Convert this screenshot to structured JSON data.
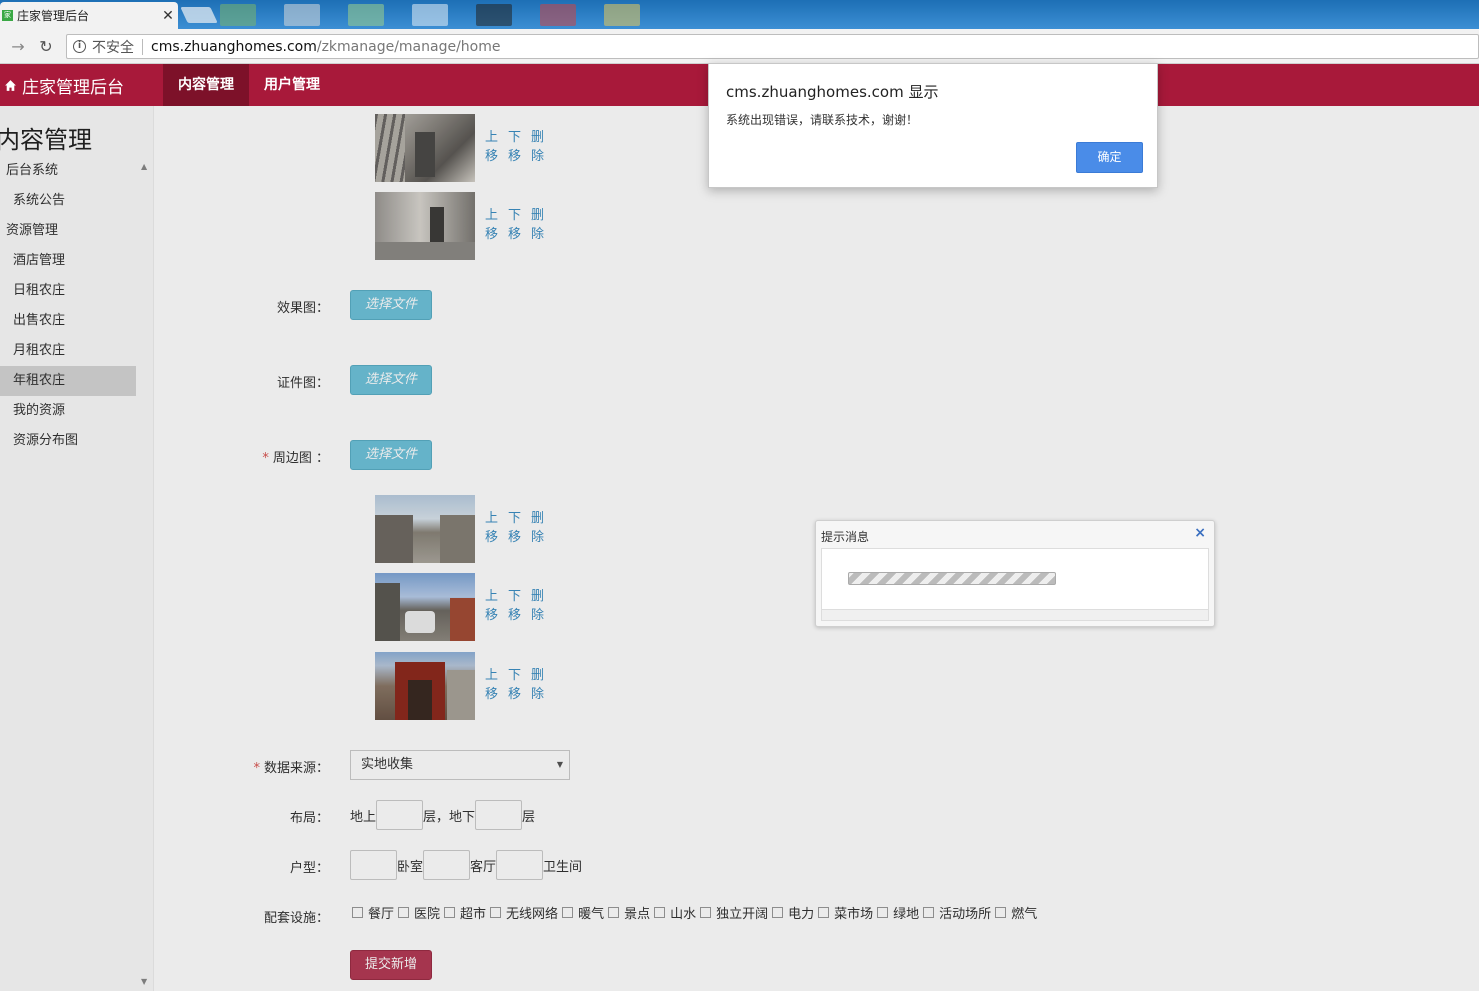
{
  "browser": {
    "tab_title": "庄家管理后台",
    "tab_favicon": "家",
    "insecure_label": "不安全",
    "url_host": "cms.zhuanghomes.com",
    "url_path": "/zkmanage/manage/home"
  },
  "header": {
    "brand": "庄家管理后台",
    "nav": [
      "内容管理",
      "用户管理"
    ]
  },
  "sidebar": {
    "title": "内容管理",
    "items": [
      {
        "label": "后台系统",
        "type": "group"
      },
      {
        "label": "系统公告",
        "type": "sub"
      },
      {
        "label": "资源管理",
        "type": "group"
      },
      {
        "label": "酒店管理",
        "type": "sub"
      },
      {
        "label": "日租农庄",
        "type": "sub"
      },
      {
        "label": "出售农庄",
        "type": "sub"
      },
      {
        "label": "月租农庄",
        "type": "sub"
      },
      {
        "label": "年租农庄",
        "type": "sub",
        "selected": true
      },
      {
        "label": "我的资源",
        "type": "sub"
      },
      {
        "label": "资源分布图",
        "type": "sub"
      }
    ]
  },
  "image_actions": {
    "up": "上移",
    "down": "下移",
    "delete": "删除"
  },
  "form": {
    "effect_label": "效果图：",
    "cert_label": "证件图：",
    "surround_label": "周边图 ：",
    "required_mark": "*",
    "file_button": "选择文件",
    "source_label": "数据来源：",
    "source_value": "实地收集",
    "layout_label": "布局：",
    "layout_above": "地上",
    "layout_floor1": "层，地下",
    "layout_floor2": "层",
    "house_label": "户型：",
    "bedroom": "卧室",
    "livingroom": "客厅",
    "bathroom": "卫生间",
    "facilities_label": "配套设施：",
    "facilities": [
      "餐厅",
      "医院",
      "超市",
      "无线网络",
      "暖气",
      "景点",
      "山水",
      "独立开阔",
      "电力",
      "菜市场",
      "绿地",
      "活动场所",
      "燃气"
    ],
    "submit": "提交新增"
  },
  "alert": {
    "title": "cms.zhuanghomes.com 显示",
    "message": "系统出现错误，请联系技术，谢谢！",
    "ok": "确定"
  },
  "msgbox": {
    "title": "提示消息",
    "close": "×"
  }
}
